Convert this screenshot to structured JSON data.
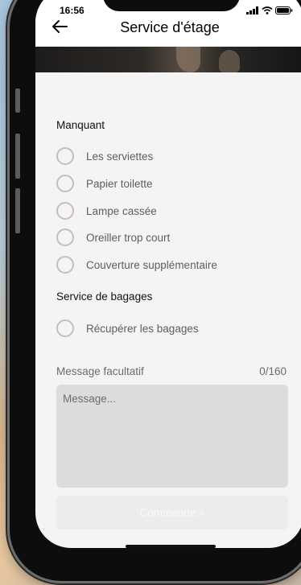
{
  "status_bar": {
    "time": "16:56"
  },
  "header": {
    "title": "Service d'étage",
    "back_icon": "arrow-left-icon"
  },
  "sections": {
    "missing": {
      "label": "Manquant",
      "options": [
        {
          "label": "Les serviettes",
          "checked": false
        },
        {
          "label": "Papier toilette",
          "checked": false
        },
        {
          "label": "Lampe cassée",
          "checked": false
        },
        {
          "label": "Oreiller trop court",
          "checked": false
        },
        {
          "label": "Couverture supplémentaire",
          "checked": false
        }
      ]
    },
    "luggage": {
      "label": "Service de bagages",
      "options": [
        {
          "label": "Récupérer les bagages",
          "checked": false
        }
      ]
    }
  },
  "message": {
    "label": "Message facultatif",
    "counter": "0/160",
    "placeholder": "Message...",
    "value": ""
  },
  "order_button": {
    "label": "Commande »"
  },
  "colors": {
    "radio_border": "#c9bcbb",
    "textarea_bg": "#dcdcdc",
    "button_bg": "#ececec",
    "screen_bg": "#f4f4f4"
  }
}
